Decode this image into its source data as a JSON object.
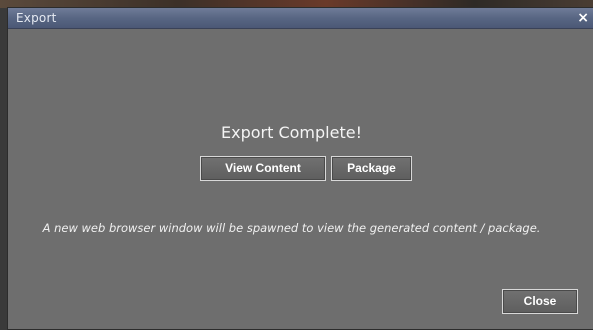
{
  "window": {
    "title": "Export",
    "close_glyph": "×"
  },
  "main": {
    "headline": "Export Complete!",
    "view_content_label": "View Content",
    "package_label": "Package",
    "info_text": "A new web browser window will be spawned to view the generated content / package."
  },
  "footer": {
    "close_label": "Close"
  },
  "colors": {
    "titlebar": "#586683",
    "dialog_bg": "#6e6e6e",
    "button_border": "#d8d8d8"
  }
}
